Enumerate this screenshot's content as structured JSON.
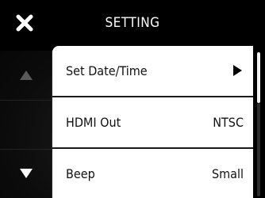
{
  "header": {
    "close_icon": "close-x-icon",
    "title": "SETTING"
  },
  "nav": {
    "up_icon": "triangle-up-icon",
    "up_state": "disabled",
    "down_icon": "triangle-down-icon",
    "down_state": "enabled"
  },
  "menu": {
    "items": [
      {
        "label": "Set Date/Time",
        "value": "",
        "icon": "triangle-right-icon"
      },
      {
        "label": "HDMI Out",
        "value": "NTSC"
      },
      {
        "label": "Beep",
        "value": "Small"
      }
    ]
  },
  "scroll": {
    "position_fraction": 0.0,
    "visible_fraction": 0.35
  },
  "colors": {
    "background": "#000000",
    "menu_bg": "#ffffff",
    "text_dark": "#111111",
    "text_light": "#ffffff",
    "disabled_icon": "#555555"
  }
}
